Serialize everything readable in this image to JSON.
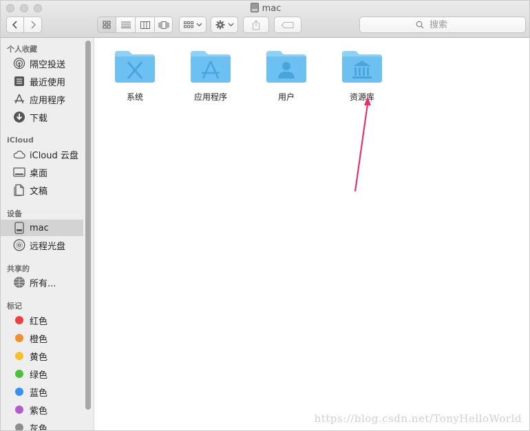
{
  "window": {
    "title": "mac"
  },
  "toolbar": {
    "search_placeholder": "搜索"
  },
  "sidebar": {
    "sections": [
      {
        "label": "个人收藏"
      },
      {
        "label": "iCloud"
      },
      {
        "label": "设备"
      },
      {
        "label": "共享的"
      },
      {
        "label": "标记"
      }
    ],
    "favorites": [
      {
        "label": "隔空投送",
        "icon": "airdrop-icon"
      },
      {
        "label": "最近使用",
        "icon": "recents-icon"
      },
      {
        "label": "应用程序",
        "icon": "applications-icon"
      },
      {
        "label": "下载",
        "icon": "downloads-icon"
      }
    ],
    "icloud": [
      {
        "label": "iCloud 云盘",
        "icon": "cloud-icon"
      },
      {
        "label": "桌面",
        "icon": "desktop-icon"
      },
      {
        "label": "文稿",
        "icon": "documents-icon"
      }
    ],
    "devices": [
      {
        "label": "mac",
        "icon": "hard-disk-icon",
        "selected": true
      },
      {
        "label": "远程光盘",
        "icon": "optical-disc-icon"
      }
    ],
    "shared": [
      {
        "label": "所有...",
        "icon": "network-icon"
      }
    ],
    "tags": [
      {
        "label": "红色",
        "color": "#ec4141"
      },
      {
        "label": "橙色",
        "color": "#f3902e"
      },
      {
        "label": "黄色",
        "color": "#f5c12f"
      },
      {
        "label": "绿色",
        "color": "#4cc13a"
      },
      {
        "label": "蓝色",
        "color": "#3a8ff0"
      },
      {
        "label": "紫色",
        "color": "#b55ccd"
      },
      {
        "label": "灰色",
        "color": "#8e8e8e"
      }
    ]
  },
  "folders": [
    {
      "label": "系统",
      "icon": "system-folder-icon"
    },
    {
      "label": "应用程序",
      "icon": "applications-folder-icon"
    },
    {
      "label": "用户",
      "icon": "users-folder-icon"
    },
    {
      "label": "资源库",
      "icon": "library-folder-icon"
    }
  ],
  "colors": {
    "folder_body": "#6cc0f2",
    "folder_tab": "#8fd0f6",
    "folder_glyph": "#4aa5dc",
    "annotation_arrow": "#e2336b"
  },
  "watermark": "https://blog.csdn.net/TonyHelloWorld"
}
